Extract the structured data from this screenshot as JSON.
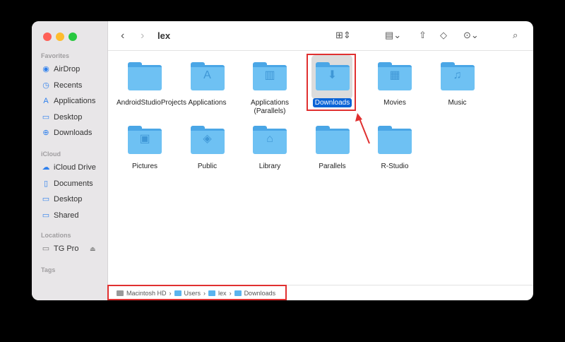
{
  "window": {
    "title": "lex"
  },
  "sidebar": {
    "favorites_label": "Favorites",
    "favorites": [
      {
        "label": "AirDrop",
        "icon": "airdrop-icon"
      },
      {
        "label": "Recents",
        "icon": "clock-icon"
      },
      {
        "label": "Applications",
        "icon": "applications-icon"
      },
      {
        "label": "Desktop",
        "icon": "desktop-icon"
      },
      {
        "label": "Downloads",
        "icon": "download-icon"
      }
    ],
    "icloud_label": "iCloud",
    "icloud": [
      {
        "label": "iCloud Drive",
        "icon": "cloud-icon"
      },
      {
        "label": "Documents",
        "icon": "document-icon"
      },
      {
        "label": "Desktop",
        "icon": "desktop-icon"
      },
      {
        "label": "Shared",
        "icon": "shared-folder-icon"
      }
    ],
    "locations_label": "Locations",
    "locations": [
      {
        "label": "TG Pro",
        "icon": "drive-icon"
      }
    ],
    "tags_label": "Tags"
  },
  "items": [
    {
      "label": "AndroidStudioProjects",
      "glyph": ""
    },
    {
      "label": "Applications",
      "glyph": "A"
    },
    {
      "label": "Applications (Parallels)",
      "glyph": "▥"
    },
    {
      "label": "Downloads",
      "glyph": "⬇"
    },
    {
      "label": "Movies",
      "glyph": "▦"
    },
    {
      "label": "Music",
      "glyph": "♫"
    },
    {
      "label": "Pictures",
      "glyph": "▣"
    },
    {
      "label": "Public",
      "glyph": "◈"
    },
    {
      "label": "Library",
      "glyph": "⌂"
    },
    {
      "label": "Parallels",
      "glyph": ""
    },
    {
      "label": "R-Studio",
      "glyph": ""
    }
  ],
  "selected": "Downloads",
  "pathbar": [
    "Macintosh HD",
    "Users",
    "lex",
    "Downloads"
  ]
}
